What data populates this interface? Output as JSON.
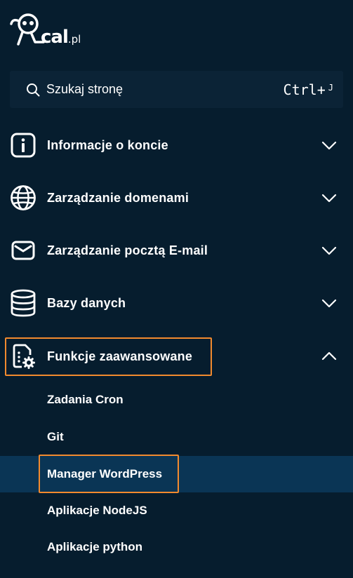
{
  "logo": {
    "text": "cal",
    "suffix": ".pl"
  },
  "search": {
    "placeholder": "Szukaj stronę",
    "shortcut": "Ctrl+",
    "shortcut_key": "J"
  },
  "menu": {
    "items": [
      {
        "label": "Informacje o koncie",
        "icon": "info-icon",
        "expanded": false
      },
      {
        "label": "Zarządzanie domenami",
        "icon": "globe-icon",
        "expanded": false
      },
      {
        "label": "Zarządzanie pocztą E-mail",
        "icon": "mail-icon",
        "expanded": false
      },
      {
        "label": "Bazy danych",
        "icon": "database-icon",
        "expanded": false
      },
      {
        "label": "Funkcje zaawansowane",
        "icon": "advanced-settings-icon",
        "expanded": true,
        "highlighted": true
      }
    ],
    "subitems": [
      {
        "label": "Zadania Cron",
        "active": false
      },
      {
        "label": "Git",
        "active": false
      },
      {
        "label": "Manager WordPress",
        "active": true,
        "highlighted": true
      },
      {
        "label": "Aplikacje NodeJS",
        "active": false
      },
      {
        "label": "Aplikacje python",
        "active": false
      }
    ]
  },
  "colors": {
    "background": "#061d2e",
    "search_bg": "#0b2336",
    "active_bg": "#0a3555",
    "highlight": "#f28a2e"
  }
}
